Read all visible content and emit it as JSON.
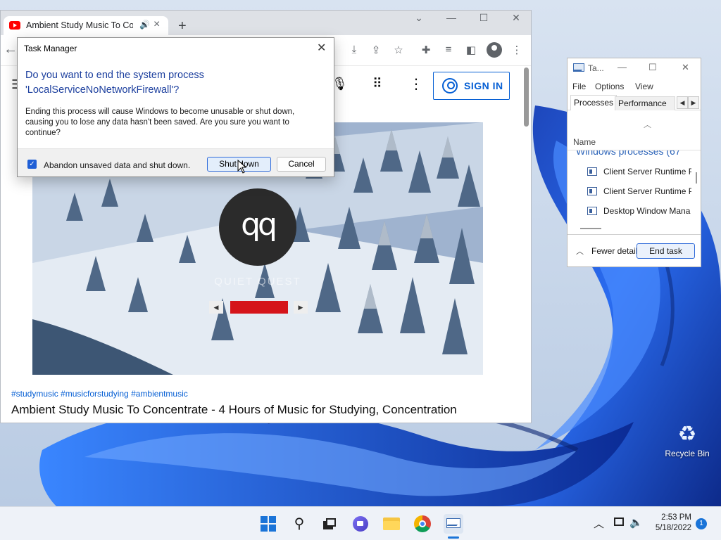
{
  "browser": {
    "tab_title": "Ambient Study Music To Con",
    "new_tab_glyph": "+",
    "window_minimize_glyph": "—",
    "window_maximize_glyph": "☐",
    "window_close_glyph": "✕",
    "chevron_glyph": "⌄",
    "toolbar_icons": [
      "install-icon",
      "share-icon",
      "star-icon",
      "extensions-icon",
      "media-icon",
      "sidebar-icon",
      "profile-icon",
      "more-icon"
    ]
  },
  "youtube": {
    "sign_in_label": "SIGN IN",
    "brand_logo_text": "qq",
    "brand_text": "QUIET QUEST",
    "progress_fraction": 1.0,
    "hashtags": "#studymusic #musicforstudying #ambientmusic",
    "video_title": "Ambient Study Music To Concentrate - 4 Hours of Music for Studying, Concentration",
    "accent_color": "#065fd4"
  },
  "dialog": {
    "window_title": "Task Manager",
    "heading": "Do you want to end the system process 'LocalServiceNoNetworkFirewall'?",
    "body": "Ending this process will cause Windows to become unusable or shut down, causing you to lose any data hasn't been saved. Are you sure you want to continue?",
    "checkbox_label": "Abandon unsaved data and shut down.",
    "checkbox_checked": true,
    "primary_button": "Shut down",
    "secondary_button": "Cancel"
  },
  "task_manager": {
    "title": "Ta...",
    "menu": [
      "File",
      "Options",
      "View"
    ],
    "tabs": [
      "Processes",
      "Performance"
    ],
    "column_header": "Name",
    "group_label": "Windows processes (67",
    "processes": [
      "Client Server Runtime P",
      "Client Server Runtime P",
      "Desktop Window Mana"
    ],
    "fewer_details_label": "Fewer detail",
    "end_task_label": "End task"
  },
  "desktop": {
    "recycle_bin_label": "Recycle Bin"
  },
  "taskbar": {
    "icons": [
      "start-icon",
      "search-icon",
      "task-view-icon",
      "chat-icon",
      "file-explorer-icon",
      "chrome-icon",
      "task-manager-icon"
    ],
    "time": "2:53 PM",
    "date": "5/18/2022",
    "notification_count": "1"
  }
}
